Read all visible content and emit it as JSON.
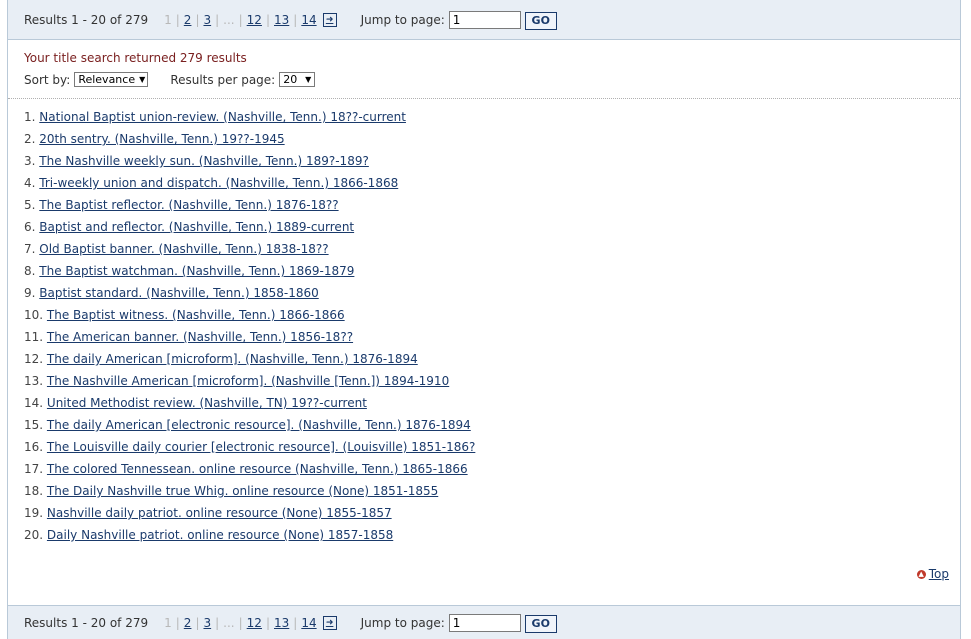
{
  "pagination": {
    "results_count": "Results 1 - 20 of 279",
    "current_page": "1",
    "pages": [
      "2",
      "3"
    ],
    "ellipsis": "...",
    "last_pages": [
      "12",
      "13",
      "14"
    ],
    "next_icon": "next-page-arrow-icon",
    "jump_label": "Jump to page:",
    "jump_value": "1",
    "go_label": "GO"
  },
  "summary": {
    "message": "Your title search returned 279 results",
    "sort_label": "Sort by:",
    "sort_value": "Relevance",
    "per_page_label": "Results per page:",
    "per_page_value": "20"
  },
  "results": [
    {
      "num": "1.",
      "title": "National Baptist union-review. (Nashville, Tenn.) 18??-current"
    },
    {
      "num": "2.",
      "title": "20th sentry. (Nashville, Tenn.) 19??-1945"
    },
    {
      "num": "3.",
      "title": "The Nashville weekly sun. (Nashville, Tenn.) 189?-189?"
    },
    {
      "num": "4.",
      "title": "Tri-weekly union and dispatch. (Nashville, Tenn.) 1866-1868"
    },
    {
      "num": "5.",
      "title": "The Baptist reflector. (Nashville, Tenn.) 1876-18??"
    },
    {
      "num": "6.",
      "title": "Baptist and reflector. (Nashville, Tenn.) 1889-current"
    },
    {
      "num": "7.",
      "title": "Old Baptist banner. (Nashville, Tenn.) 1838-18??"
    },
    {
      "num": "8.",
      "title": "The Baptist watchman. (Nashville, Tenn.) 1869-1879"
    },
    {
      "num": "9.",
      "title": "Baptist standard. (Nashville, Tenn.) 1858-1860"
    },
    {
      "num": "10.",
      "title": "The Baptist witness. (Nashville, Tenn.) 1866-1866"
    },
    {
      "num": "11.",
      "title": "The American banner. (Nashville, Tenn.) 1856-18??"
    },
    {
      "num": "12.",
      "title": "The daily American [microform]. (Nashville, Tenn.) 1876-1894"
    },
    {
      "num": "13.",
      "title": "The Nashville American [microform]. (Nashville [Tenn.]) 1894-1910"
    },
    {
      "num": "14.",
      "title": "United Methodist review. (Nashville, TN) 19??-current"
    },
    {
      "num": "15.",
      "title": "The daily American [electronic resource]. (Nashville, Tenn.) 1876-1894"
    },
    {
      "num": "16.",
      "title": "The Louisville daily courier [electronic resource]. (Louisville) 1851-186?"
    },
    {
      "num": "17.",
      "title": "The colored Tennessean. online resource (Nashville, Tenn.) 1865-1866"
    },
    {
      "num": "18.",
      "title": "The Daily Nashville true Whig. online resource (None) 1851-1855"
    },
    {
      "num": "19.",
      "title": "Nashville daily patriot. online resource (None) 1855-1857"
    },
    {
      "num": "20.",
      "title": "Daily Nashville patriot. online resource (None) 1857-1858"
    }
  ],
  "top_link": {
    "label": "Top",
    "icon": "arrow-up-circle-icon"
  },
  "colors": {
    "link": "#1a3a6b",
    "bar_bg": "#e8eef5",
    "message": "#7a2020",
    "top_icon": "#c0392b"
  }
}
